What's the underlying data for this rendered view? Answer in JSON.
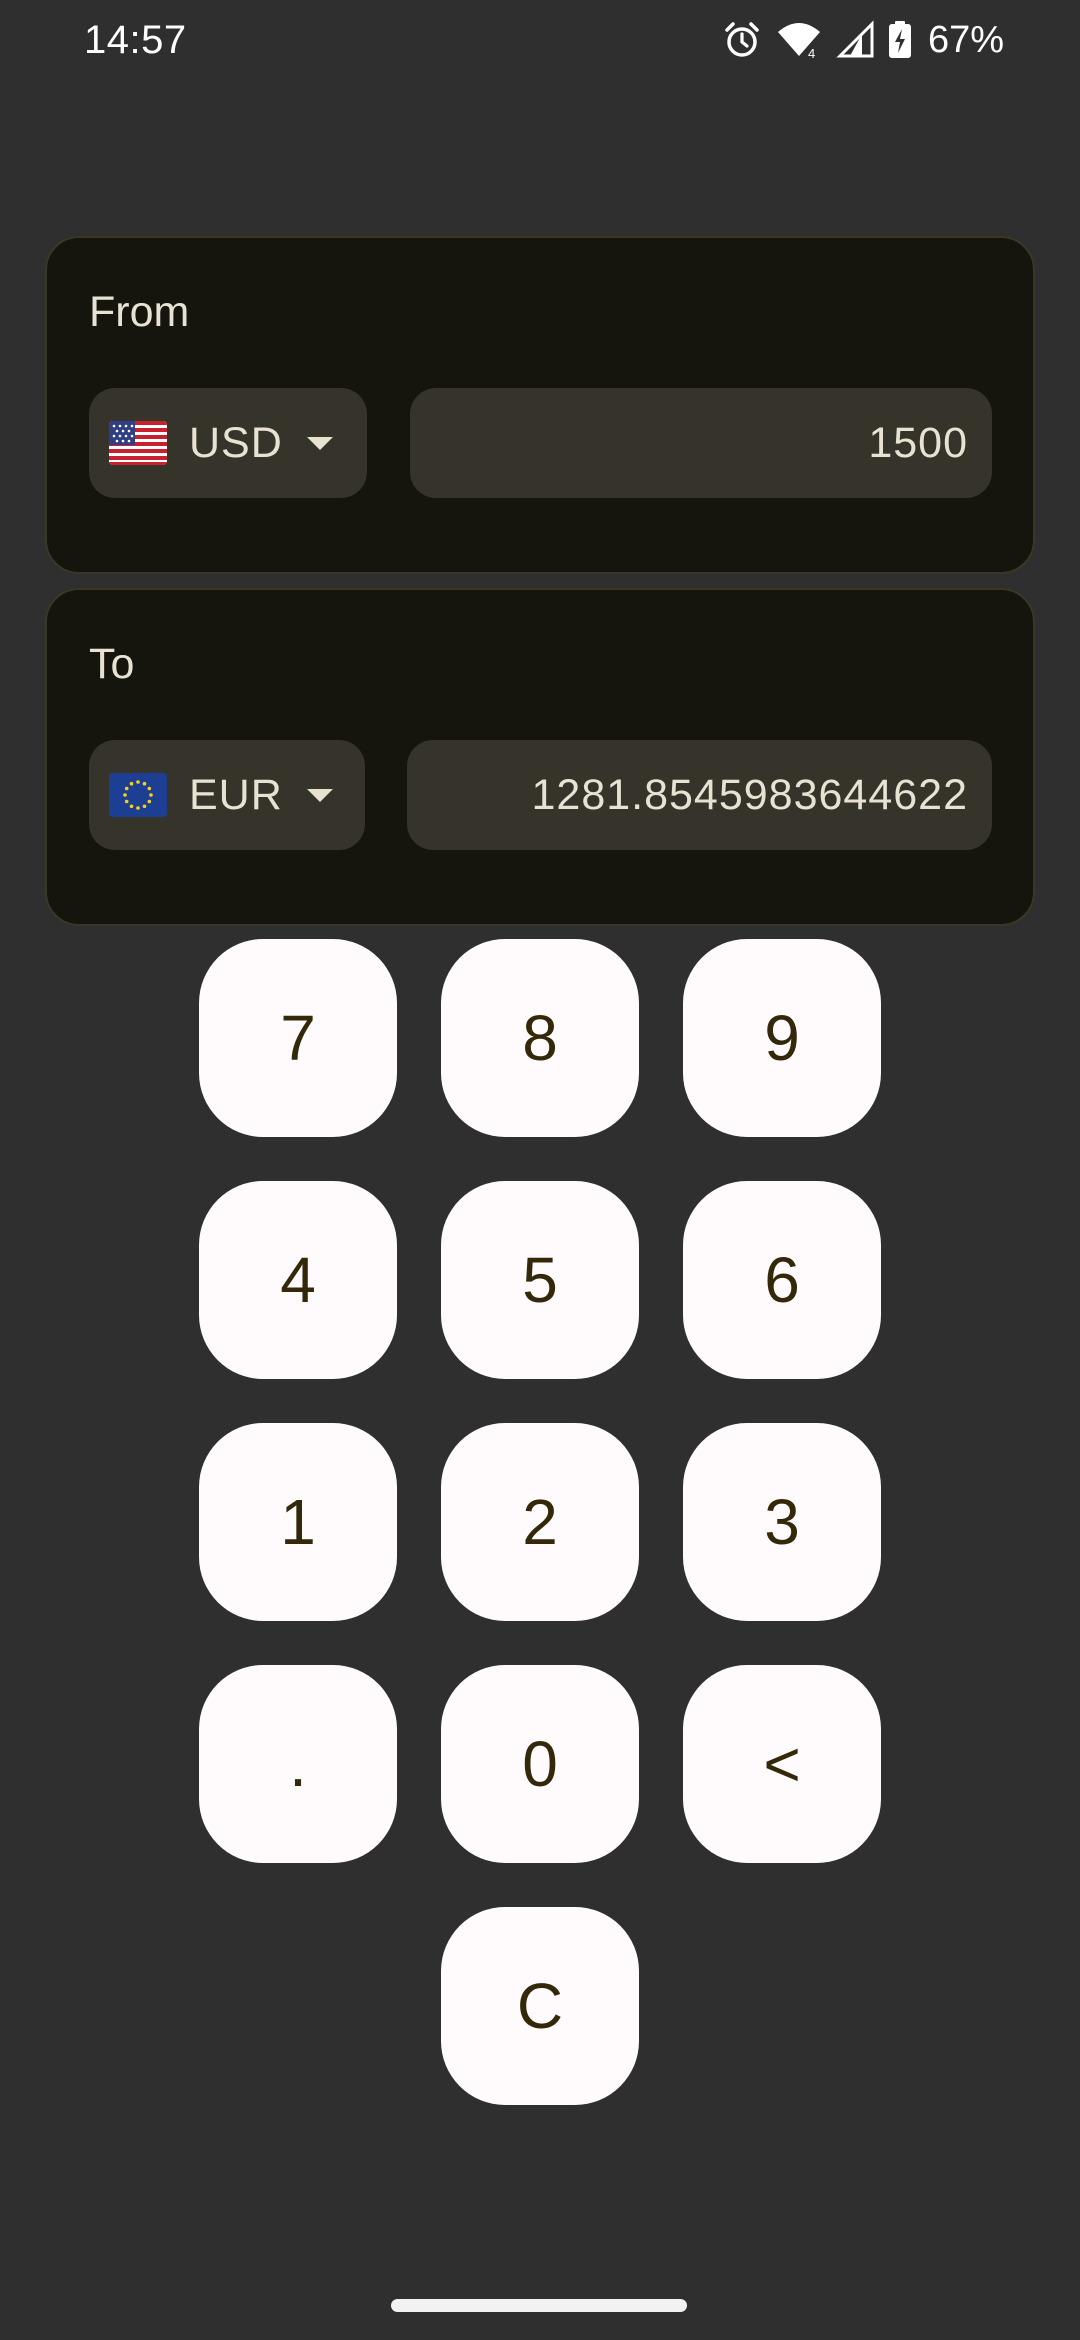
{
  "status_bar": {
    "time": "14:57",
    "battery": "67%",
    "icons": [
      "alarm-icon",
      "wifi-icon",
      "cell-signal-icon",
      "battery-charging-icon"
    ]
  },
  "from": {
    "label": "From",
    "currency": "USD",
    "flag": "us-flag-icon",
    "amount": "1500"
  },
  "to": {
    "label": "To",
    "currency": "EUR",
    "flag": "eu-flag-icon",
    "amount": "1281.8545983644622"
  },
  "keypad": {
    "k7": "7",
    "k8": "8",
    "k9": "9",
    "k4": "4",
    "k5": "5",
    "k6": "6",
    "k1": "1",
    "k2": "2",
    "k3": "3",
    "kdot": ".",
    "k0": "0",
    "kback": "<",
    "kclear": "C"
  },
  "colors": {
    "background": "#2f2f30",
    "card": "#15140d",
    "field": "#36342a",
    "key": "#fffbfd",
    "key_text": "#33290a"
  }
}
